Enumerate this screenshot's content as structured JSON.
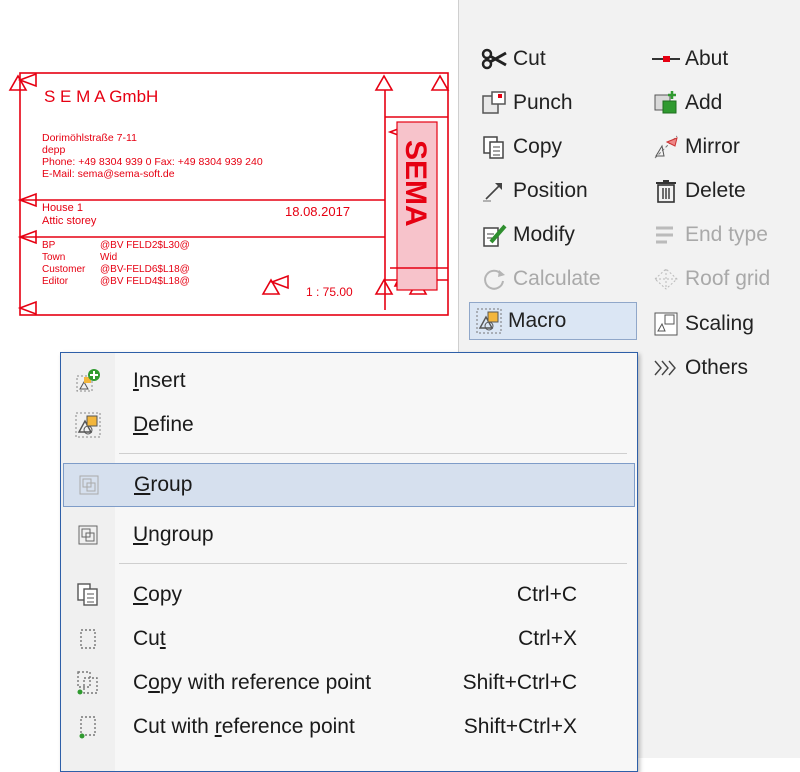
{
  "stamp": {
    "company": "S E M A GmbH",
    "address_lines": [
      "Dorimöhlstraße 7-11",
      "depp",
      "Phone: +49 8304 939 0  Fax: +49 8304 939 240",
      "E-Mail: sema@sema-soft.de"
    ],
    "house": "House 1",
    "storey": "Attic storey",
    "date": "18.08.2017",
    "fields": [
      {
        "label": "BP",
        "value": "@BV FELD2$L30@"
      },
      {
        "label": "Town",
        "value": "Wid"
      },
      {
        "label": "Customer",
        "value": "@BV-FELD6$L18@"
      },
      {
        "label": "Editor",
        "value": "@BV FELD4$L18@"
      }
    ],
    "scale": "1 : 75.00",
    "logo": "SEMA",
    "color": "#e60012"
  },
  "ribbon": {
    "left": [
      {
        "label": "Cut",
        "icon": "scissors-icon",
        "enabled": true
      },
      {
        "label": "Punch",
        "icon": "punch-icon",
        "enabled": true
      },
      {
        "label": "Copy",
        "icon": "copy-icon",
        "enabled": true
      },
      {
        "label": "Position",
        "icon": "position-icon",
        "enabled": true
      },
      {
        "label": "Modify",
        "icon": "modify-icon",
        "enabled": true
      },
      {
        "label": "Calculate",
        "icon": "calculate-icon",
        "enabled": false
      },
      {
        "label": "Macro",
        "icon": "macro-icon",
        "enabled": true,
        "selected": true
      }
    ],
    "right": [
      {
        "label": "Abut",
        "icon": "abut-icon",
        "enabled": true
      },
      {
        "label": "Add",
        "icon": "add-icon",
        "enabled": true
      },
      {
        "label": "Mirror",
        "icon": "mirror-icon",
        "enabled": true
      },
      {
        "label": "Delete",
        "icon": "delete-icon",
        "enabled": true
      },
      {
        "label": "End type",
        "icon": "end-type-icon",
        "enabled": false
      },
      {
        "label": "Roof grid",
        "icon": "roof-grid-icon",
        "enabled": false
      },
      {
        "label": "Scaling",
        "icon": "scaling-icon",
        "enabled": true
      },
      {
        "label": "Others",
        "icon": "others-chevron-icon",
        "enabled": true
      }
    ]
  },
  "menu": {
    "items": [
      {
        "pre": "",
        "key": "I",
        "post": "nsert",
        "shortcut": "",
        "icon": "insert-icon"
      },
      {
        "pre": "",
        "key": "D",
        "post": "efine",
        "shortcut": "",
        "icon": "define-icon"
      },
      {
        "pre": "",
        "key": "G",
        "post": "roup",
        "shortcut": "",
        "icon": "group-icon",
        "highlighted": true
      },
      {
        "pre": "",
        "key": "U",
        "post": "ngroup",
        "shortcut": "",
        "icon": "ungroup-icon"
      },
      {
        "pre": "",
        "key": "C",
        "post": "opy",
        "shortcut": "Ctrl+C",
        "icon": "copy-icon"
      },
      {
        "pre": "Cu",
        "key": "t",
        "post": "",
        "shortcut": "Ctrl+X",
        "icon": "cut-icon"
      },
      {
        "pre": "C",
        "key": "o",
        "post": "py with reference point",
        "shortcut": "Shift+Ctrl+C",
        "icon": "copy-reference-icon"
      },
      {
        "pre": "Cut with ",
        "key": "r",
        "post": "eference point",
        "shortcut": "Shift+Ctrl+X",
        "icon": "cut-reference-icon"
      }
    ],
    "accent": "#2e5fa8",
    "highlight": "#d6e0ee"
  }
}
